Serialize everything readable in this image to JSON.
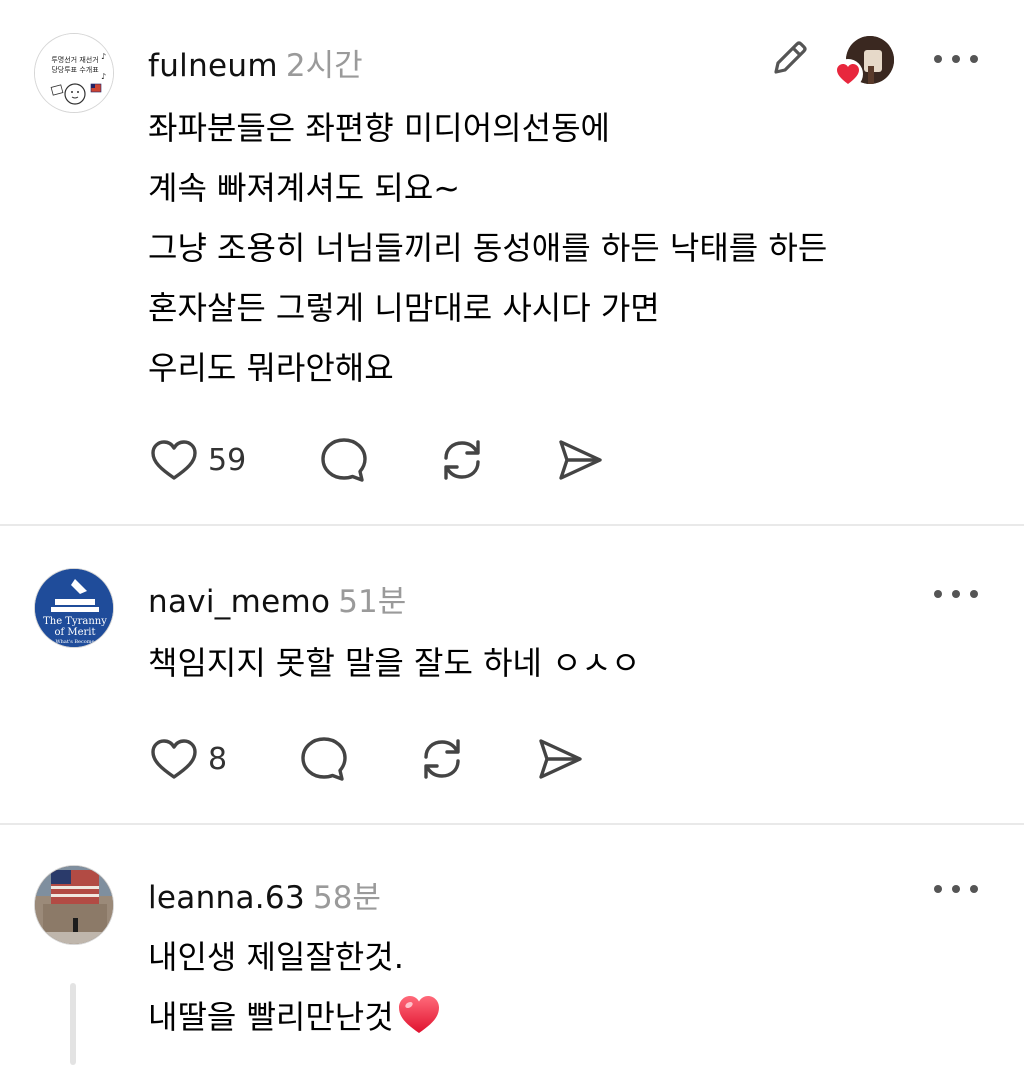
{
  "posts": [
    {
      "username": "fulneum",
      "time": "2시간",
      "avatar_text": [
        "투명선거 재선거",
        "당당투표 수개표"
      ],
      "lines": [
        "좌파분들은 좌편향 미디어의선동에",
        "계속 빠져계셔도 되요~",
        "그냥 조용히 너님들끼리 동성애를 하든 낙태를 하든",
        "혼자살든 그렇게 니맘대로 사시다 가면",
        "우리도 뭐라안해요"
      ],
      "likes": "59"
    },
    {
      "username": "navi_memo",
      "time": "51분",
      "avatar_text": [
        "The Tyranny",
        "of Merit",
        "What's Become"
      ],
      "lines": [
        "책임지지 못할 말을 잘도 하네 ㅇㅅㅇ"
      ],
      "likes": "8"
    },
    {
      "username": "leanna.63",
      "time": "58분",
      "lines": [
        "내인생 제일잘한것.",
        "내딸을 빨리만난것"
      ]
    }
  ],
  "icons": {
    "edit": "pencil-icon",
    "like": "heart-outline-icon",
    "reply": "speech-bubble-icon",
    "repost": "repost-arrows-icon",
    "share": "send-icon",
    "more": "more-dots-icon",
    "emoji": "red-heart-emoji"
  },
  "colors": {
    "text": "#000000",
    "muted": "#9a9a9a",
    "icon": "#444444",
    "heart_red": "#e8273d"
  }
}
